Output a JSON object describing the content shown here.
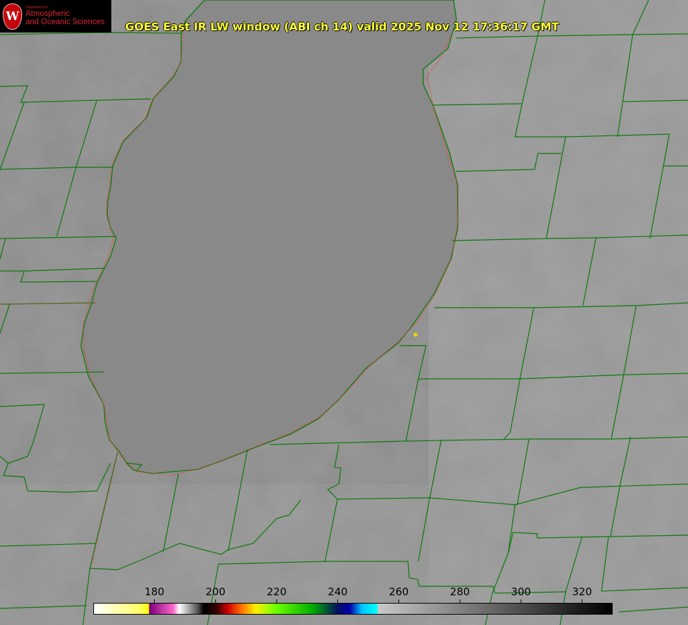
{
  "logo": {
    "seal_letter": "W",
    "dept_line": "Department of",
    "line1": "Atmospheric",
    "line2": "and Oceanic Sciences"
  },
  "title": "GOES East IR LW window (ABI ch 14) valid 2025 Nov 12 17:36:17 GMT",
  "colorbar": {
    "range": [
      160,
      330
    ],
    "ticks": [
      "180",
      "200",
      "220",
      "240",
      "260",
      "280",
      "300",
      "320"
    ],
    "stops": [
      {
        "value": 160,
        "color": "#ffffff"
      },
      {
        "value": 175,
        "color": "#ffff66"
      },
      {
        "value": 178,
        "color": "#ffff00"
      },
      {
        "value": 178.1,
        "color": "#7a0078"
      },
      {
        "value": 186,
        "color": "#ff66cc"
      },
      {
        "value": 188,
        "color": "#ffffff"
      },
      {
        "value": 194,
        "color": "#555555"
      },
      {
        "value": 196,
        "color": "#000000"
      },
      {
        "value": 200,
        "color": "#300000"
      },
      {
        "value": 204,
        "color": "#cc0000"
      },
      {
        "value": 208,
        "color": "#ff6600"
      },
      {
        "value": 213,
        "color": "#ffee00"
      },
      {
        "value": 220,
        "color": "#66ff00"
      },
      {
        "value": 232,
        "color": "#00aa00"
      },
      {
        "value": 240,
        "color": "#001060"
      },
      {
        "value": 244,
        "color": "#0000aa"
      },
      {
        "value": 248,
        "color": "#00c8ff"
      },
      {
        "value": 253,
        "color": "#00ffff"
      },
      {
        "value": 253.1,
        "color": "#c8c8c8"
      },
      {
        "value": 330,
        "color": "#000000"
      }
    ]
  },
  "colors": {
    "lake": "#8a8a8a",
    "land": "#8e8e8e",
    "borders": "#0a7a0a",
    "shoreline_dash": "#ff3030",
    "marker": "#e6d500"
  },
  "marker": {
    "name": "observation-site-dot"
  }
}
